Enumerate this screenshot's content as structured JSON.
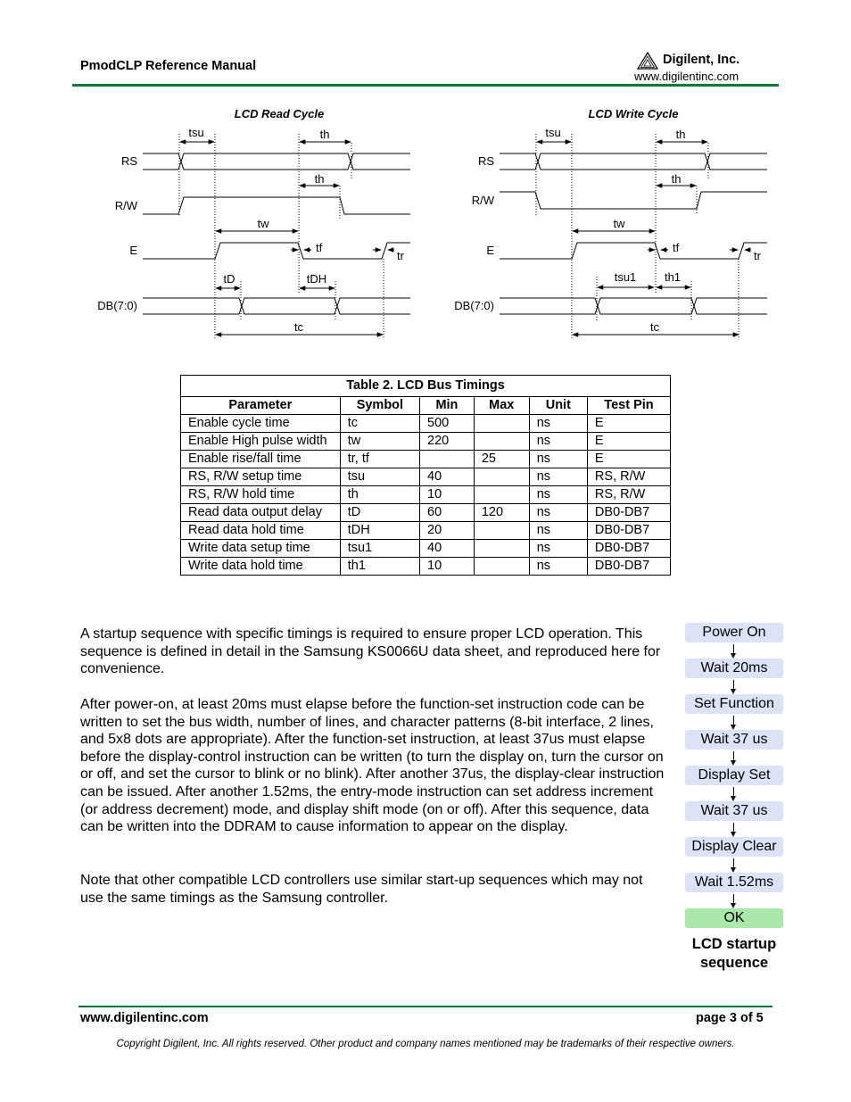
{
  "header": {
    "doc_title": "PmodCLP Reference Manual",
    "company": "Digilent, Inc.",
    "url": "www.digilentinc.com",
    "logo_icon": "digilent-triangle-logo",
    "rule_color": "#0b7a3b"
  },
  "read_cycle": {
    "title": "LCD Read Cycle",
    "signals": {
      "rs": "RS",
      "rw": "R/W",
      "e": "E",
      "db": "DB(7:0)"
    },
    "labels": {
      "tsu": "tsu",
      "th_rs": "th",
      "th_rw": "th",
      "tw": "tw",
      "tf": "tf",
      "tr": "tr",
      "t1": "tD",
      "t2": "tDH",
      "tc": "tc"
    }
  },
  "write_cycle": {
    "title": "LCD Write Cycle",
    "signals": {
      "rs": "RS",
      "rw": "R/W",
      "e": "E",
      "db": "DB(7:0)"
    },
    "labels": {
      "tsu": "tsu",
      "th_rs": "th",
      "th_rw": "th",
      "tw": "tw",
      "tf": "tf",
      "tr": "tr",
      "t1": "tsu1",
      "t2": "th1",
      "tc": "tc"
    }
  },
  "table": {
    "caption": "Table 2. LCD Bus Timings",
    "headers": [
      "Parameter",
      "Symbol",
      "Min",
      "Max",
      "Unit",
      "Test Pin"
    ],
    "rows": [
      [
        "Enable cycle time",
        "tc",
        "500",
        "",
        "ns",
        "E"
      ],
      [
        "Enable High pulse width",
        "tw",
        "220",
        "",
        "ns",
        "E"
      ],
      [
        "Enable rise/fall time",
        "tr, tf",
        "",
        "25",
        "ns",
        "E"
      ],
      [
        "RS, R/W setup time",
        "tsu",
        "40",
        "",
        "ns",
        "RS, R/W"
      ],
      [
        "RS, R/W hold time",
        "th",
        "10",
        "",
        "ns",
        "RS, R/W"
      ],
      [
        "Read data output delay",
        "tD",
        "60",
        "120",
        "ns",
        "DB0-DB7"
      ],
      [
        "Read data hold time",
        "tDH",
        "20",
        "",
        "ns",
        "DB0-DB7"
      ],
      [
        "Write data setup time",
        "tsu1",
        "40",
        "",
        "ns",
        "DB0-DB7"
      ],
      [
        "Write data hold time",
        "th1",
        "10",
        "",
        "ns",
        "DB0-DB7"
      ]
    ]
  },
  "body": {
    "paragraphs": [
      "A startup sequence with specific timings is required to ensure proper LCD operation. This sequence is defined in detail in the Samsung KS0066U data sheet, and reproduced here for convenience.",
      "After power-on, at least 20ms must elapse before the function-set instruction code can be written to set the bus width, number of lines, and character patterns (8-bit interface, 2 lines, and 5x8 dots are appropriate). After the function-set instruction, at least 37us must elapse before the display-control instruction can be written (to turn the display on, turn the cursor on or off, and set the cursor to blink or no blink). After another 37us, the display-clear instruction can be issued. After another 1.52ms, the entry-mode instruction can set address increment (or address decrement) mode, and display shift mode (on or off). After this sequence, data can be written into the DDRAM to cause information to appear on the display.",
      "Note that other compatible LCD controllers use similar start-up sequences which may not use the same timings as the Samsung controller."
    ]
  },
  "flowchart": {
    "steps": [
      "Power On",
      "Wait 20ms",
      "Set Function",
      "Wait 37 us",
      "Display Set",
      "Wait 37 us",
      "Display Clear",
      "Wait 1.52ms",
      "OK"
    ],
    "caption": "LCD startup sequence",
    "step_color": "#dde3f7",
    "final_color": "#a9e8a8"
  },
  "footer": {
    "url": "www.digilentinc.com",
    "page": "page 3 of 5",
    "copyright": "Copyright Digilent, Inc. All rights reserved. Other product and company names mentioned may be trademarks of their respective owners."
  }
}
